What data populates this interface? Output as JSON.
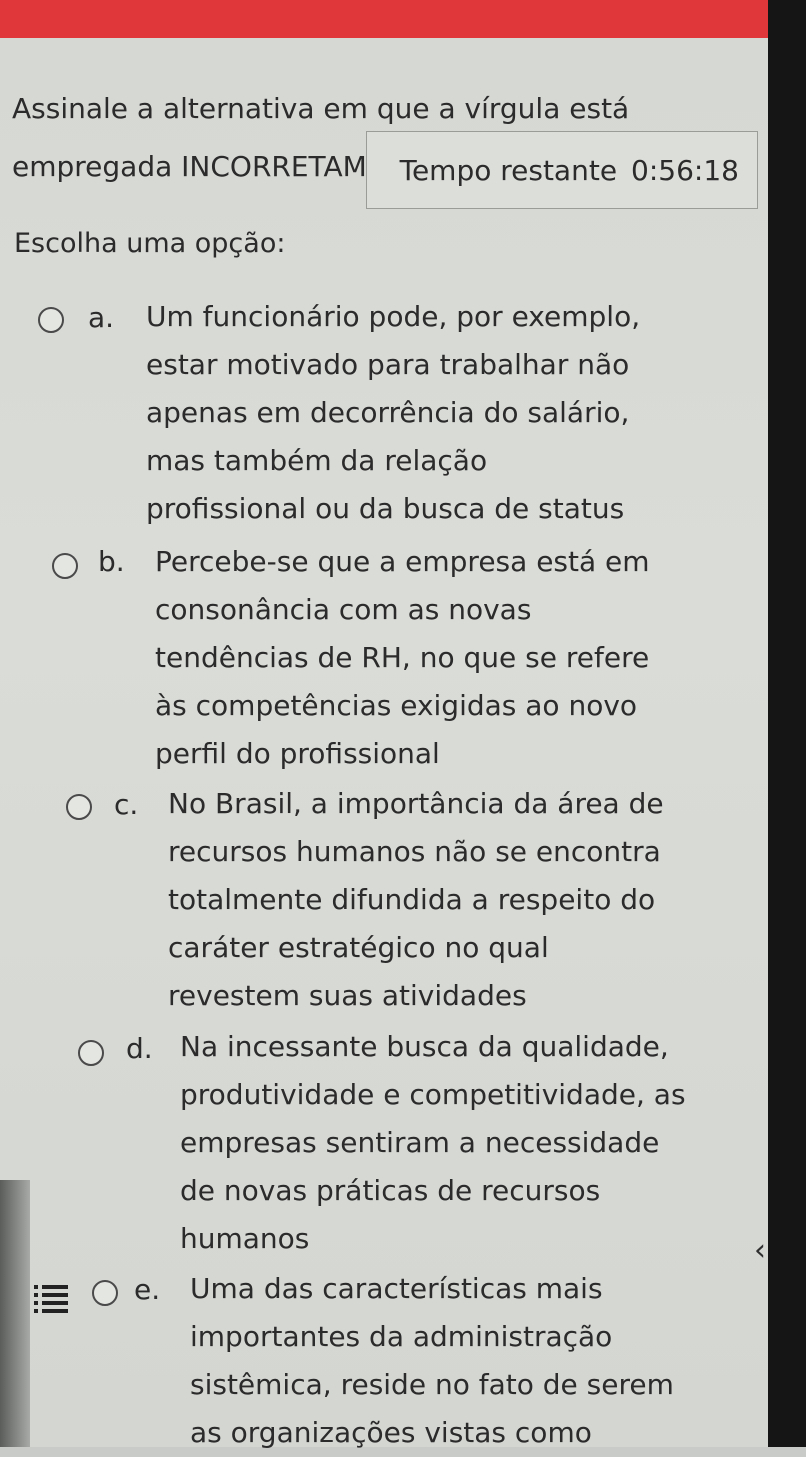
{
  "question": {
    "line1": "Assinale a alternativa em que a vírgula está",
    "line2": "empregada INCORRETAMENTE:"
  },
  "timer": {
    "label": "Tempo restante",
    "value": "0:56:18"
  },
  "choose_label": "Escolha uma opção:",
  "options": [
    {
      "letter": "a.",
      "lines": [
        "Um funcionário pode, por exemplo,",
        "estar motivado para trabalhar não",
        "apenas em decorrência do salário,",
        "mas também da relação",
        "profissional ou da busca de status"
      ]
    },
    {
      "letter": "b.",
      "lines": [
        "Percebe-se que a empresa está em",
        "consonância com as novas",
        "tendências de RH, no que se refere",
        "às competências exigidas ao novo",
        "perfil do profissional"
      ]
    },
    {
      "letter": "c.",
      "lines": [
        "No Brasil, a importância da área de",
        "recursos humanos não se encontra",
        "totalmente difundida a respeito do",
        "caráter estratégico no qual",
        "revestem suas atividades"
      ]
    },
    {
      "letter": "d.",
      "lines": [
        "Na incessante busca da qualidade,",
        "produtividade e competitividade, as",
        "empresas sentiram a necessidade",
        "de novas práticas de recursos",
        "humanos"
      ]
    },
    {
      "letter": "e.",
      "lines": [
        "Uma das características mais",
        "importantes da administração",
        "sistêmica, reside no fato de serem",
        "as organizações vistas como"
      ]
    }
  ],
  "icons": {
    "list": "list-icon",
    "back": "chevron-left-icon",
    "back_glyph": "‹"
  },
  "colors": {
    "top_bar": "#e0373b"
  }
}
